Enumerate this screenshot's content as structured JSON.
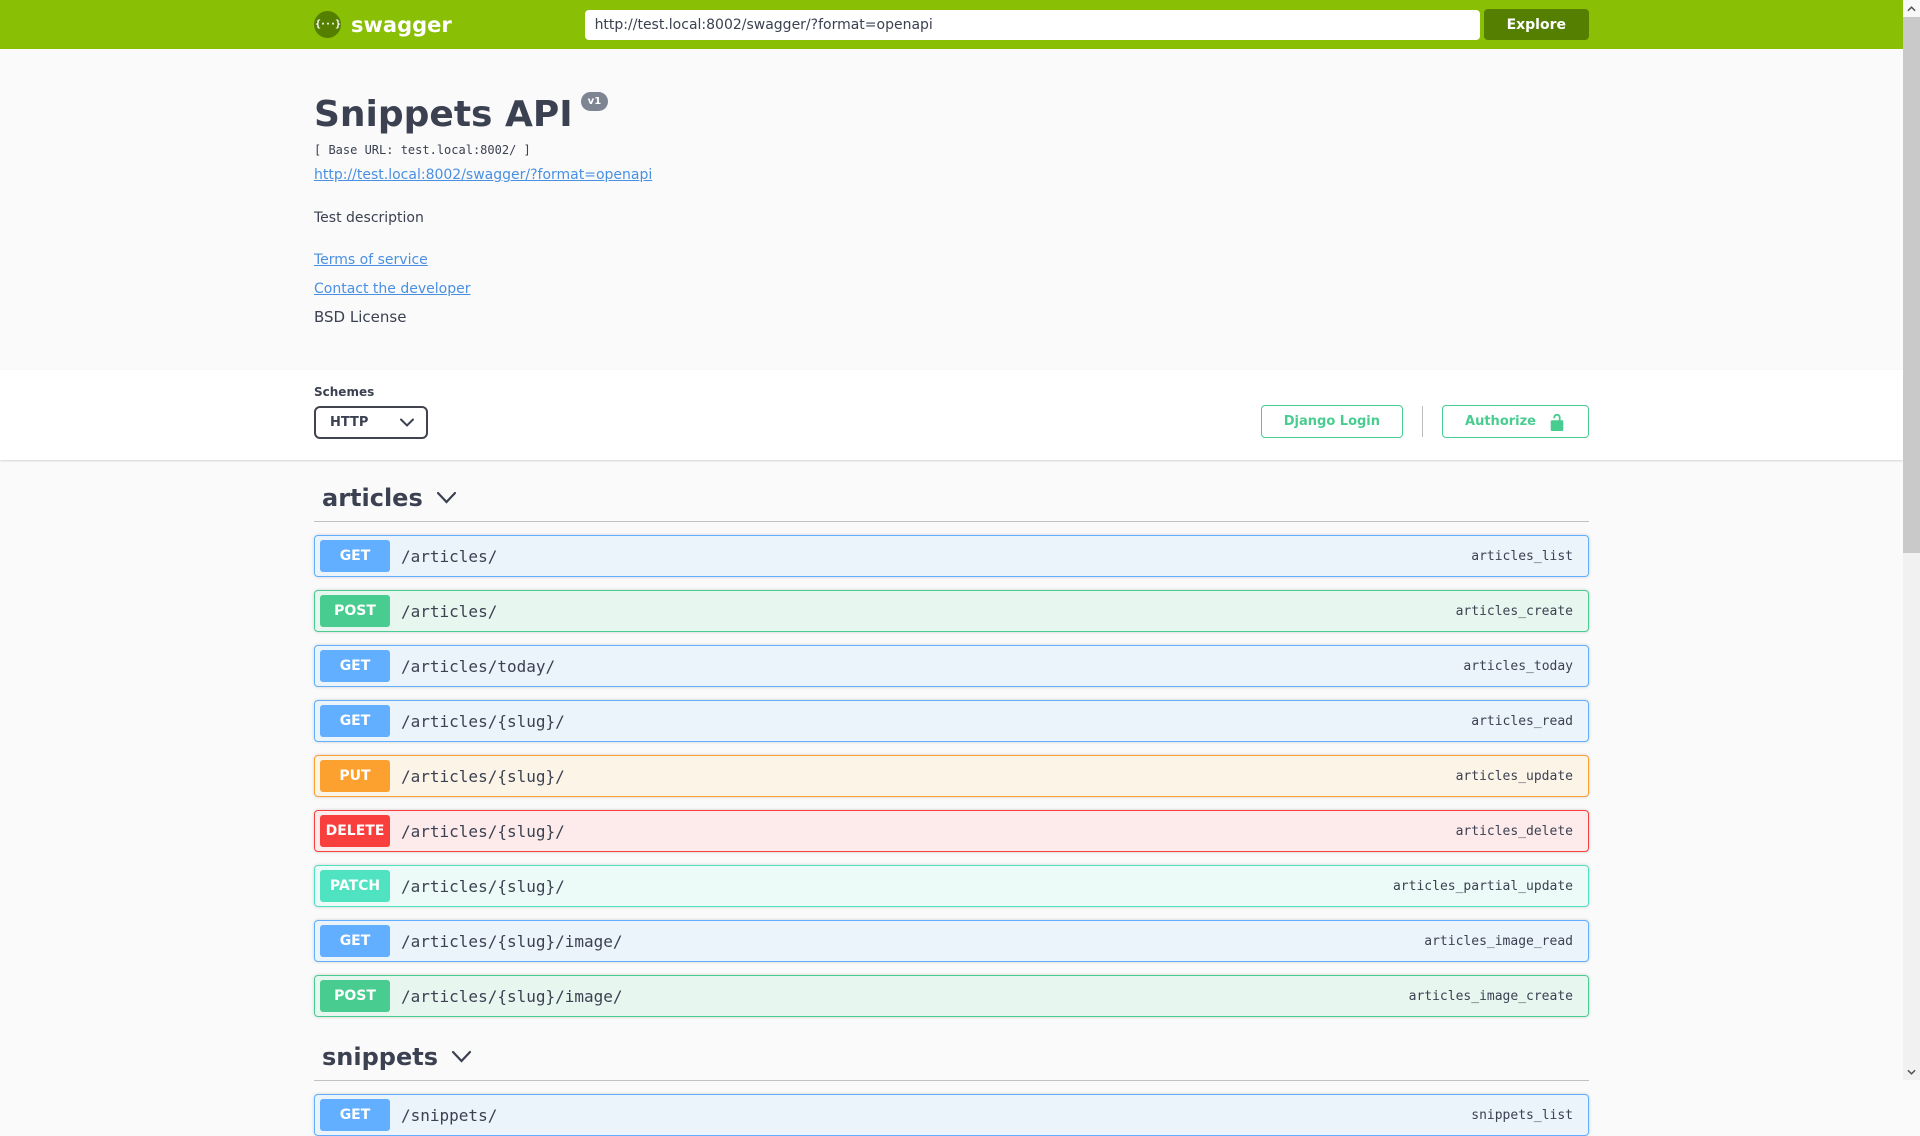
{
  "topbar": {
    "brand": "swagger",
    "logo_glyph": "{···}",
    "url_value": "http://test.local:8002/swagger/?format=openapi",
    "explore_label": "Explore"
  },
  "info": {
    "title": "Snippets API",
    "version_badge": "v1",
    "base_url_line": "[ Base URL: test.local:8002/ ]",
    "spec_link": "http://test.local:8002/swagger/?format=openapi",
    "description": "Test description",
    "terms_link": "Terms of service",
    "contact_link": "Contact the developer",
    "license_text": "BSD License"
  },
  "scheme": {
    "label": "Schemes",
    "selected": "HTTP",
    "django_login_label": "Django Login",
    "authorize_label": "Authorize"
  },
  "sections": [
    {
      "name": "articles",
      "operations": [
        {
          "method": "GET",
          "path": "/articles/",
          "operation_id": "articles_list"
        },
        {
          "method": "POST",
          "path": "/articles/",
          "operation_id": "articles_create"
        },
        {
          "method": "GET",
          "path": "/articles/today/",
          "operation_id": "articles_today"
        },
        {
          "method": "GET",
          "path": "/articles/{slug}/",
          "operation_id": "articles_read"
        },
        {
          "method": "PUT",
          "path": "/articles/{slug}/",
          "operation_id": "articles_update"
        },
        {
          "method": "DELETE",
          "path": "/articles/{slug}/",
          "operation_id": "articles_delete"
        },
        {
          "method": "PATCH",
          "path": "/articles/{slug}/",
          "operation_id": "articles_partial_update"
        },
        {
          "method": "GET",
          "path": "/articles/{slug}/image/",
          "operation_id": "articles_image_read"
        },
        {
          "method": "POST",
          "path": "/articles/{slug}/image/",
          "operation_id": "articles_image_create"
        }
      ]
    },
    {
      "name": "snippets",
      "operations": [
        {
          "method": "GET",
          "path": "/snippets/",
          "operation_id": "snippets_list"
        }
      ]
    }
  ],
  "colors": {
    "topbar_green": "#89bf04",
    "dark_green": "#547f00",
    "get": "#61affe",
    "post": "#49cc90",
    "put": "#fca130",
    "delete": "#f93e3e",
    "patch": "#50e3c2",
    "auth_green": "#49cc90",
    "link_blue": "#4990e2",
    "text": "#3b4151",
    "version_badge_bg": "#7d8492"
  }
}
